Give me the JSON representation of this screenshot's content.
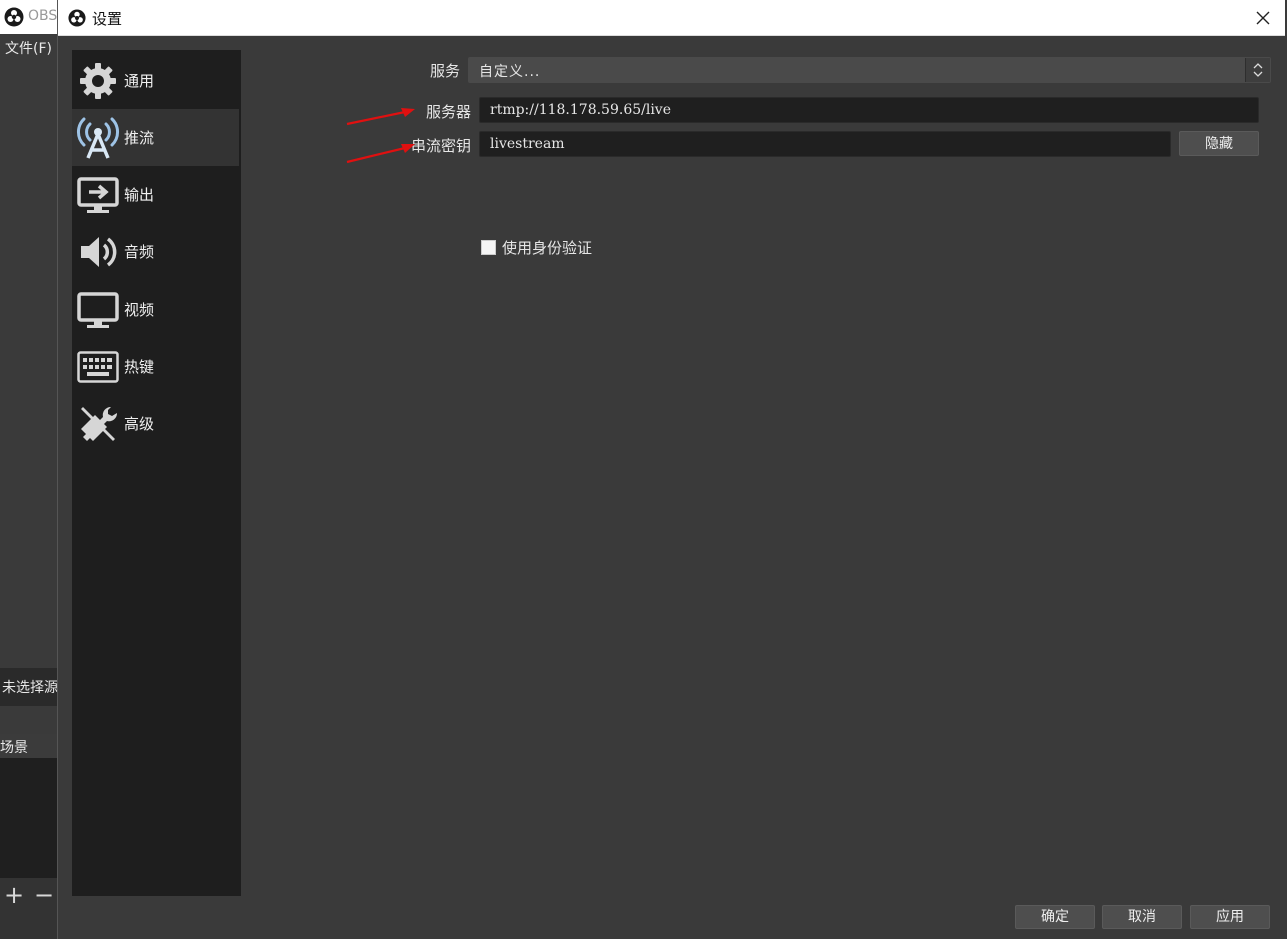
{
  "background_window": {
    "title": "OBS",
    "menu_file": "文件(F)",
    "no_source_text": "未选择源",
    "scenes_header": "场景",
    "add_icon": "+",
    "remove_icon": "−"
  },
  "dialog": {
    "title": "设置",
    "close_icon": "close-icon"
  },
  "sidebar": {
    "items": [
      {
        "label": "通用",
        "icon": "gear-icon"
      },
      {
        "label": "推流",
        "icon": "broadcast-antenna-icon",
        "active": true
      },
      {
        "label": "输出",
        "icon": "output-monitor-icon"
      },
      {
        "label": "音频",
        "icon": "speaker-icon"
      },
      {
        "label": "视频",
        "icon": "monitor-icon"
      },
      {
        "label": "热键",
        "icon": "keyboard-icon"
      },
      {
        "label": "高级",
        "icon": "wrench-screwdriver-icon"
      }
    ]
  },
  "stream": {
    "service_label": "服务",
    "service_value": "自定义...",
    "server_label": "服务器",
    "server_value": "rtmp://118.178.59.65/live",
    "key_label": "串流密钥",
    "key_value": "livestream",
    "hide_button": "隐藏",
    "auth_label": "使用身份验证",
    "auth_checked": false
  },
  "buttons": {
    "ok": "确定",
    "cancel": "取消",
    "apply": "应用"
  },
  "colors": {
    "dialog_bg": "#3a3a3a",
    "sidebar_bg": "#1e1e1e",
    "input_bg": "#1f1f1f",
    "annotation_arrow": "#e01010"
  }
}
